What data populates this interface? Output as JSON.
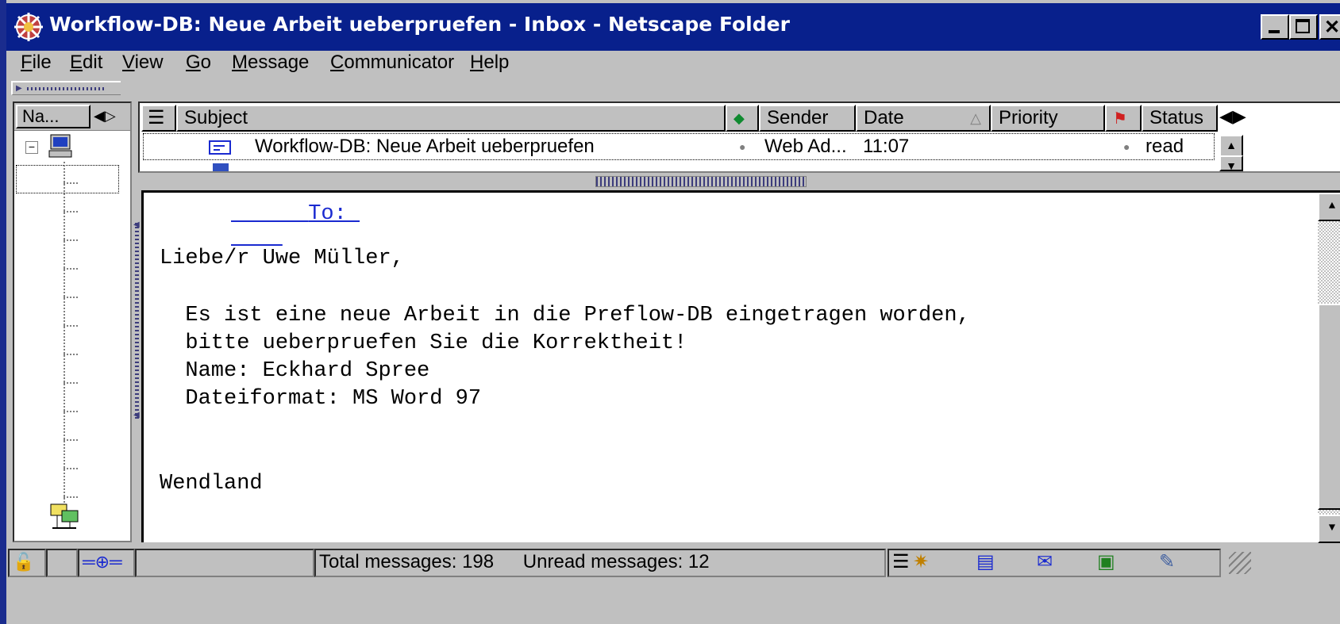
{
  "window": {
    "title": "Workflow-DB: Neue Arbeit ueberpruefen - Inbox - Netscape Folder"
  },
  "menu": {
    "items": [
      {
        "label": "File",
        "accel": "F",
        "rest": "ile"
      },
      {
        "label": "Edit",
        "accel": "E",
        "rest": "dit"
      },
      {
        "label": "View",
        "accel": "V",
        "rest": "iew"
      },
      {
        "label": "Go",
        "accel": "G",
        "rest": "o"
      },
      {
        "label": "Message",
        "accel": "M",
        "rest": "essage"
      },
      {
        "label": "Communicator",
        "accel": "C",
        "rest": "ommunicator"
      },
      {
        "label": "Help",
        "accel": "H",
        "rest": "elp"
      }
    ]
  },
  "folder_pane": {
    "column_label": "Na..."
  },
  "message_list": {
    "columns": {
      "subject": "Subject",
      "sender": "Sender",
      "date": "Date",
      "priority": "Priority",
      "status": "Status"
    },
    "rows": [
      {
        "subject": "Workflow-DB: Neue Arbeit ueberpruefen",
        "sender": "Web Ad...",
        "date": "11:07",
        "status": "read"
      }
    ]
  },
  "message_body": {
    "to_line": "To: ",
    "lines": [
      "Liebe/r Uwe Müller,",
      "  Es ist eine neue Arbeit in die Preflow-DB eingetragen worden,",
      "  bitte ueberpruefen Sie die Korrektheit!",
      "  Name: Eckhard Spree",
      "  Dateiformat: MS Word 97",
      "Wendland"
    ]
  },
  "status_bar": {
    "total": "Total messages: 198",
    "unread": "Unread messages: 12"
  },
  "colors": {
    "title_bg": "#08208c",
    "chrome": "#c0c0c0",
    "link": "#1a2ad0"
  }
}
